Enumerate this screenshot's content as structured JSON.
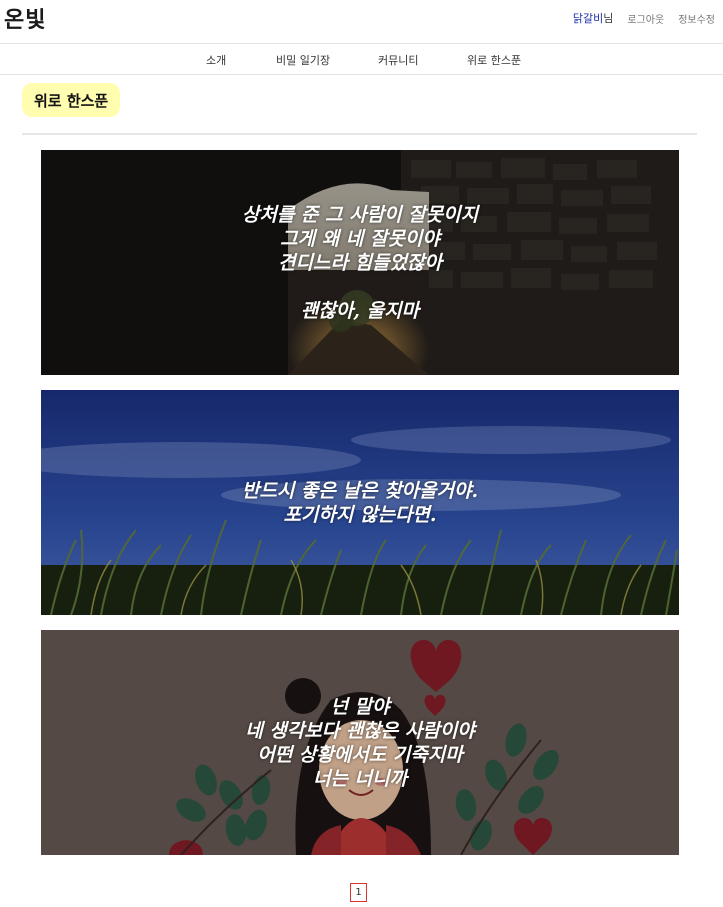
{
  "header": {
    "logo": "온빛",
    "username": "닭갈비",
    "username_suffix": "님",
    "logout": "로그아웃",
    "edit_profile": "정보수정"
  },
  "nav": {
    "items": [
      "소개",
      "비밀 일기장",
      "커뮤니티",
      "위로 한스푼"
    ]
  },
  "page": {
    "title": "위로 한스푼"
  },
  "cards": [
    {
      "quote": "상처를 준 그 사람이 잘못이지\n그게 왜 네 잘못이야\n견디느라 힘들었잖아\n\n괜찮아, 울지마"
    },
    {
      "quote": "반드시 좋은 날은 찾아올거야.\n포기하지 않는다면."
    },
    {
      "quote": "넌 말야\n네 생각보다 괜찮은 사람이야\n어떤 상황에서도 기죽지마\n너는 너니까"
    }
  ],
  "pagination": {
    "current": "1"
  },
  "colors": {
    "title_bg": "#fffdb0",
    "username": "#1d2fa8",
    "pager_border": "#dd3333"
  }
}
